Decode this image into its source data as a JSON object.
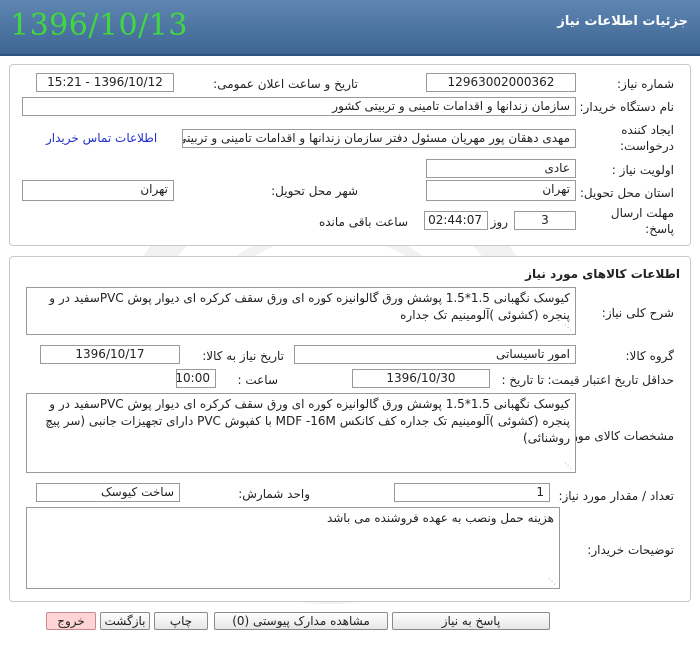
{
  "header": {
    "title": "جزئیات اطلاعات نیاز",
    "date_big": "1396/10/13"
  },
  "info": {
    "need_number_label": "شماره نیاز:",
    "need_number": "1296300200036 2",
    "announce_label": "تاریخ و ساعت اعلان عمومی:",
    "announce_value": "1396/10/12 - 15:21",
    "buyer_org_label": "نام دستگاه خریدار:",
    "buyer_org": "سازمان زندانها و اقدامات تامینی و تربیتی کشور",
    "creator_label_1": "ایجاد کننده",
    "creator_label_2": "درخواست:",
    "creator_value": "مهدی  دهقان پور مهریان مسئول دفتر سازمان زندانها و اقدامات تامینی و تربیتی",
    "contact_link": "اطلاعات تماس خریدار",
    "priority_label": "اولویت نیاز :",
    "priority_value": "عادی",
    "province_label": "استان محل تحویل:",
    "province_value": "تهران",
    "city_label": "شهر محل تحویل:",
    "city_value": "تهران",
    "deadline_label_1": "مهلت ارسال",
    "deadline_label_2": "پاسخ:",
    "deadline_days": "3",
    "days_word": "روز و",
    "deadline_time": "02:44:07",
    "remaining_word": "ساعت باقی مانده"
  },
  "goods": {
    "section_title": "اطلاعات کالاهای مورد نیاز",
    "summary_label": "شرح کلی نیاز:",
    "summary_value": "کیوسک نگهبانی 1.5*1.5 پوشش ورق گالوانیزه کوره ای ورق سقف کرکره ای دیوار پوش PVCسفید در و پنجره (کشوئی )آلومینیم تک جداره",
    "group_label": "گروه کالا:",
    "group_value": "امور تاسیساتی",
    "need_date_label": "تاریخ نیاز به کالا:",
    "need_date_value": "1396/10/17",
    "min_validity_label": "حداقل تاریخ اعتبار قیمت:",
    "to_date_label": "تا تاریخ :",
    "to_date_value": "1396/10/30",
    "hour_label": "ساعت :",
    "hour_value": "10:00",
    "specs_label": "مشخصات کالای مورد نیاز:",
    "specs_value": "کیوسک نگهبانی 1.5*1.5 پوشش ورق گالوانیزه کوره ای ورق سقف کرکره ای دیوار پوش PVCسفید در و پنجره (کشوئی )آلومینیم تک جداره کف کانکس MDF -16M با کفپوش PVC دارای تجهیزات  جانبی (سر پیچ روشنائی)",
    "qty_label": "تعداد / مقدار مورد نیاز:",
    "qty_value": "1",
    "unit_label": "واحد شمارش:",
    "unit_value": "ساخت کیوسک",
    "buyer_notes_label": "توضیحات خریدار:",
    "buyer_notes_value": "هزینه حمل ونصب به عهده فروشنده می باشد"
  },
  "buttons": {
    "reply": "پاسخ به نیاز",
    "attachments": "مشاهده مدارک پیوستی (0)",
    "print": "چاپ",
    "back": "بازگشت",
    "exit": "خروج"
  }
}
